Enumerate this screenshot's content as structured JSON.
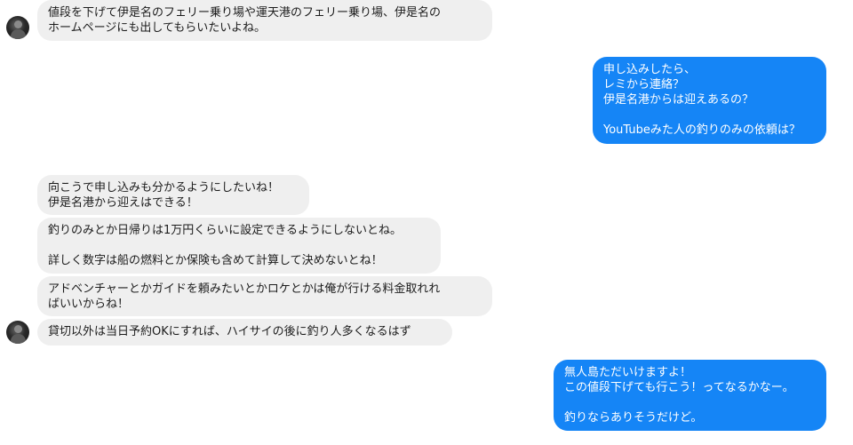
{
  "messages": [
    {
      "side": "in",
      "text": "値段を下げて伊是名のフェリー乗り場や運天港のフェリー乗り場、伊是名の\nホームページにも出してもらいたいよね。"
    },
    {
      "side": "out",
      "text": "申し込みしたら、\nレミから連絡？\n伊是名港からは迎えあるの？\n\nYouTubeみた人の釣りのみの依頼は？"
    },
    {
      "side": "in",
      "text": "向こうで申し込みも分かるようにしたいね！\n伊是名港から迎えはできる！"
    },
    {
      "side": "in",
      "text": "釣りのみとか日帰りは1万円くらいに設定できるようにしないとね。\n\n詳しく数字は船の燃料とか保険も含めて計算して決めないとね！"
    },
    {
      "side": "in",
      "text": "アドベンチャーとかガイドを頼みたいとかロケとかは俺が行ける料金取れれ\nばいいからね！"
    },
    {
      "side": "in",
      "text": "貸切以外は当日予約OKにすれば、ハイサイの後に釣り人多くなるはず"
    },
    {
      "side": "out",
      "text": "無人島ただいけますよ！\nこの値段下げても行こう！ってなるかなー。\n\n釣りならありそうだけど。"
    }
  ]
}
